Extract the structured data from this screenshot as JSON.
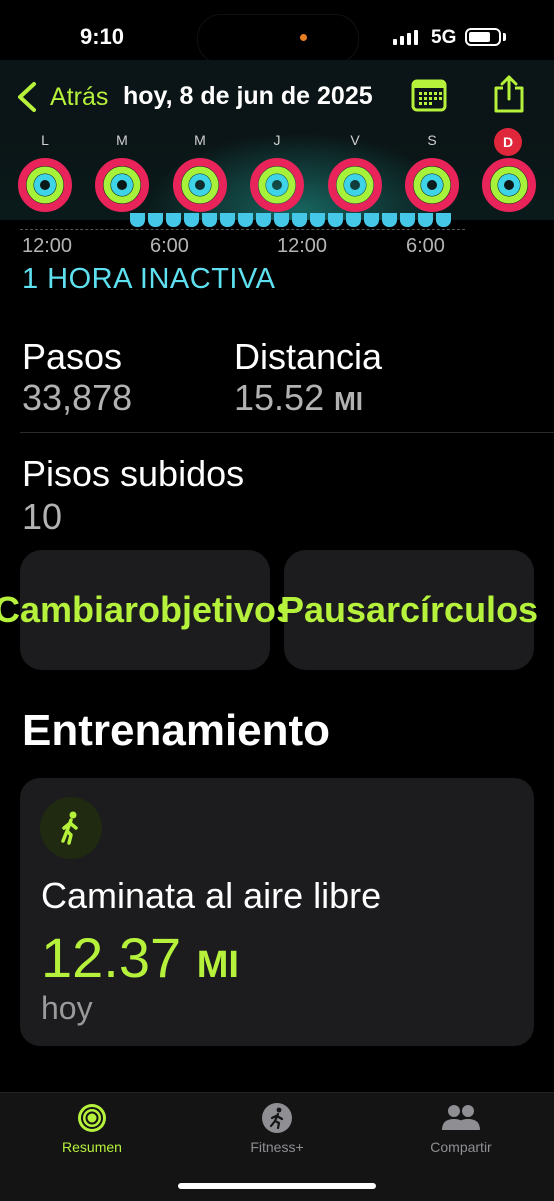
{
  "status": {
    "time": "9:10",
    "network": "5G",
    "battery_level": 0.75
  },
  "header": {
    "back_label": "Atrás",
    "title": "hoy, 8 de jun de 2025"
  },
  "week": {
    "days": [
      "L",
      "M",
      "M",
      "J",
      "V",
      "S",
      "D"
    ]
  },
  "timeline": {
    "ticks": [
      "12:00",
      "6:00",
      "12:00",
      "6:00"
    ],
    "inactive_label": "1 HORA INACTIVA"
  },
  "stats": {
    "steps": {
      "label": "Pasos",
      "value": "33,878"
    },
    "distance": {
      "label": "Distancia",
      "value": "15.52",
      "unit": "MI"
    },
    "floors": {
      "label": "Pisos subidos",
      "value": "10"
    }
  },
  "actions": {
    "change_goals": "Cambiar objetivos",
    "pause_rings": "Pausar círculos"
  },
  "workouts": {
    "section_title": "Entrenamiento",
    "items": [
      {
        "name": "Caminata al aire libre",
        "distance": "12.37",
        "unit": "MI",
        "date": "hoy"
      }
    ]
  },
  "tabs": [
    {
      "label": "Resumen",
      "active": true
    },
    {
      "label": "Fitness+",
      "active": false
    },
    {
      "label": "Compartir",
      "active": false
    }
  ],
  "colors": {
    "accent": "#b6f23c",
    "move": "#e8245a",
    "exercise": "#a6f23a",
    "stand": "#3fd3e8",
    "today": "#e0263a"
  }
}
